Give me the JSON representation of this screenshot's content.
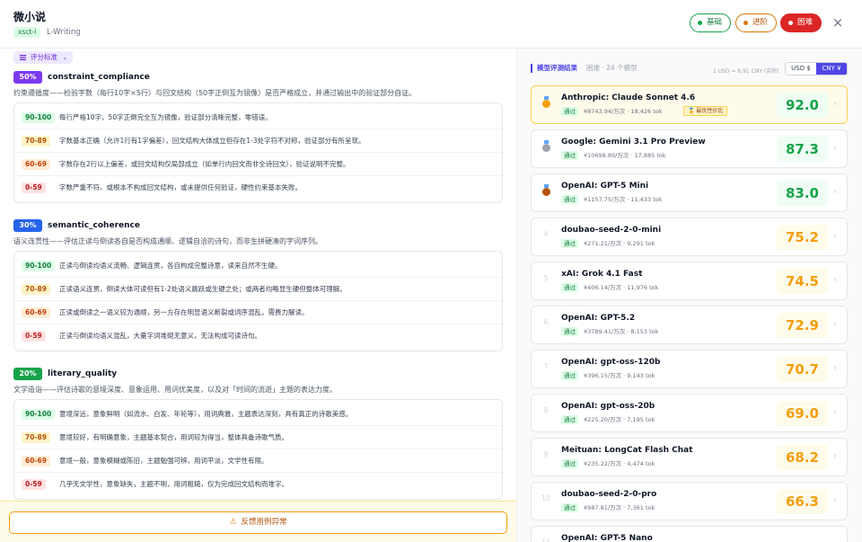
{
  "header": {
    "title": "微小说",
    "tag": "xsct-l",
    "subtitle": "L-Writing",
    "difficulty": {
      "easy": "基础",
      "medium": "进阶",
      "hard": "困难"
    },
    "close_symbol": "×"
  },
  "criteria_selector": {
    "label": "评分标准",
    "chevron": "⌄"
  },
  "sections": [
    {
      "weight": "50%",
      "name": "constraint_compliance",
      "color": "#7c3aed",
      "description": "约束遵循度——检验字数（每行10字×5行）与回文结构（50字正倒互为镜像）是否严格成立，并通过输出中的验证部分自证。",
      "levels": [
        {
          "range": "90-100",
          "text": "每行严格10字，50字正倒完全互为镜像，验证部分清晰完整，零错误。"
        },
        {
          "range": "70-89",
          "text": "字数基本正确（允许1行有1字偏差），回文结构大体成立但存在1-3处字符不对称，验证部分有所呈现。"
        },
        {
          "range": "60-69",
          "text": "字数存在2行以上偏差，或回文结构仅局部成立（如单行内回文而非全诗回文），验证说明不完整。"
        },
        {
          "range": "0-59",
          "text": "字数严重不符，或根本不构成回文结构，或未提供任何验证，硬性约束基本失败。"
        }
      ]
    },
    {
      "weight": "30%",
      "name": "semantic_coherence",
      "color": "#2563eb",
      "description": "语义连贯性——评估正读与倒读各自是否构成通顺、逻辑自洽的诗句，而非生拼硬凑的字词序列。",
      "levels": [
        {
          "range": "90-100",
          "text": "正读与倒读均语义流畅、逻辑连贯，各自构成完整诗意，读来自然不生硬。"
        },
        {
          "range": "70-89",
          "text": "正读语义连贯，倒读大体可读但有1-2处语义跳跃或生硬之处；或两者均略显生硬但整体可理解。"
        },
        {
          "range": "60-69",
          "text": "正读或倒读之一语义较为通顺，另一方存在明显语义断裂或词序混乱，需费力解读。"
        },
        {
          "range": "0-59",
          "text": "正读与倒读均语义混乱，大量字词堆砌无意义，无法构成可读诗句。"
        }
      ]
    },
    {
      "weight": "20%",
      "name": "literary_quality",
      "color": "#16a34a",
      "description": "文学造诣——评估诗歌的意境深度、意象运用、用词优美度，以及对「时间的流逝」主题的表达力度。",
      "levels": [
        {
          "range": "90-100",
          "text": "意境深远，意象鲜明（如流水、白发、年轮等），用词典雅，主题表达深刻，具有真正的诗歌美感。"
        },
        {
          "range": "70-89",
          "text": "意境较好，有明确意象，主题基本契合，用词较为得当，整体具备诗歌气质。"
        },
        {
          "range": "60-69",
          "text": "意境一般，意象模糊或陈旧，主题勉强可辨，用词平淡，文学性有限。"
        },
        {
          "range": "0-59",
          "text": "几乎无文学性，意象缺失，主题不明，用词粗糙，仅为完成回文结构而堆字。"
        }
      ]
    }
  ],
  "footer": {
    "report_label": "反馈用例异常",
    "warn_symbol": "⚠"
  },
  "results": {
    "title": "模型评测结果",
    "meta": "困难 · 24 个模型",
    "fx_note": "1 USD = 6.91 CNY (实时)",
    "currency": {
      "usd": "USD $",
      "cny": "CNY ¥",
      "selected": "CNY ¥"
    },
    "models": [
      {
        "rank": "1",
        "medal": "gold",
        "name": "Anthropic: Claude Sonnet 4.6",
        "status": "通过",
        "cost": "¥8743.94/万次 · 18,426 tok",
        "badge": "🏅 最优性价比",
        "score": "92.0",
        "tier": "green"
      },
      {
        "rank": "2",
        "medal": "silver",
        "name": "Google: Gemini 3.1 Pro Preview",
        "status": "通过",
        "cost": "¥10698.89/万次 · 17,885 tok",
        "badge": "",
        "score": "87.3",
        "tier": "green"
      },
      {
        "rank": "3",
        "medal": "bronze",
        "name": "OpenAI: GPT-5 Mini",
        "status": "通过",
        "cost": "¥1157.75/万次 · 11,433 tok",
        "badge": "",
        "score": "83.0",
        "tier": "green"
      },
      {
        "rank": "4",
        "medal": "",
        "name": "doubao-seed-2-0-mini",
        "status": "通过",
        "cost": "¥271.21/万次 · 9,291 tok",
        "badge": "",
        "score": "75.2",
        "tier": "orange"
      },
      {
        "rank": "5",
        "medal": "",
        "name": "xAI: Grok 4.1 Fast",
        "status": "通过",
        "cost": "¥406.14/万次 · 11,976 tok",
        "badge": "",
        "score": "74.5",
        "tier": "orange"
      },
      {
        "rank": "6",
        "medal": "",
        "name": "OpenAI: GPT-5.2",
        "status": "通过",
        "cost": "¥3789.41/万次 · 8,153 tok",
        "badge": "",
        "score": "72.9",
        "tier": "orange"
      },
      {
        "rank": "7",
        "medal": "",
        "name": "OpenAI: gpt-oss-120b",
        "status": "通过",
        "cost": "¥396.15/万次 · 9,143 tok",
        "badge": "",
        "score": "70.7",
        "tier": "orange"
      },
      {
        "rank": "8",
        "medal": "",
        "name": "OpenAI: gpt-oss-20b",
        "status": "通过",
        "cost": "¥225.20/万次 · 7,195 tok",
        "badge": "",
        "score": "69.0",
        "tier": "orange"
      },
      {
        "rank": "9",
        "medal": "",
        "name": "Meituan: LongCat Flash Chat",
        "status": "通过",
        "cost": "¥235.22/万次 · 4,474 tok",
        "badge": "",
        "score": "68.2",
        "tier": "orange"
      },
      {
        "rank": "10",
        "medal": "",
        "name": "doubao-seed-2-0-pro",
        "status": "通过",
        "cost": "¥987.81/万次 · 7,361 tok",
        "badge": "",
        "score": "66.3",
        "tier": "orange"
      },
      {
        "rank": "11",
        "medal": "",
        "name": "OpenAI: GPT-5 Nano",
        "status": "",
        "cost": "",
        "badge": "",
        "score": "",
        "tier": "orange"
      }
    ]
  },
  "colors": {
    "accent": "#4f46e5",
    "pass_green": "#16a34a",
    "score_orange": "#f59e0b",
    "hard_red": "#dc2626"
  }
}
